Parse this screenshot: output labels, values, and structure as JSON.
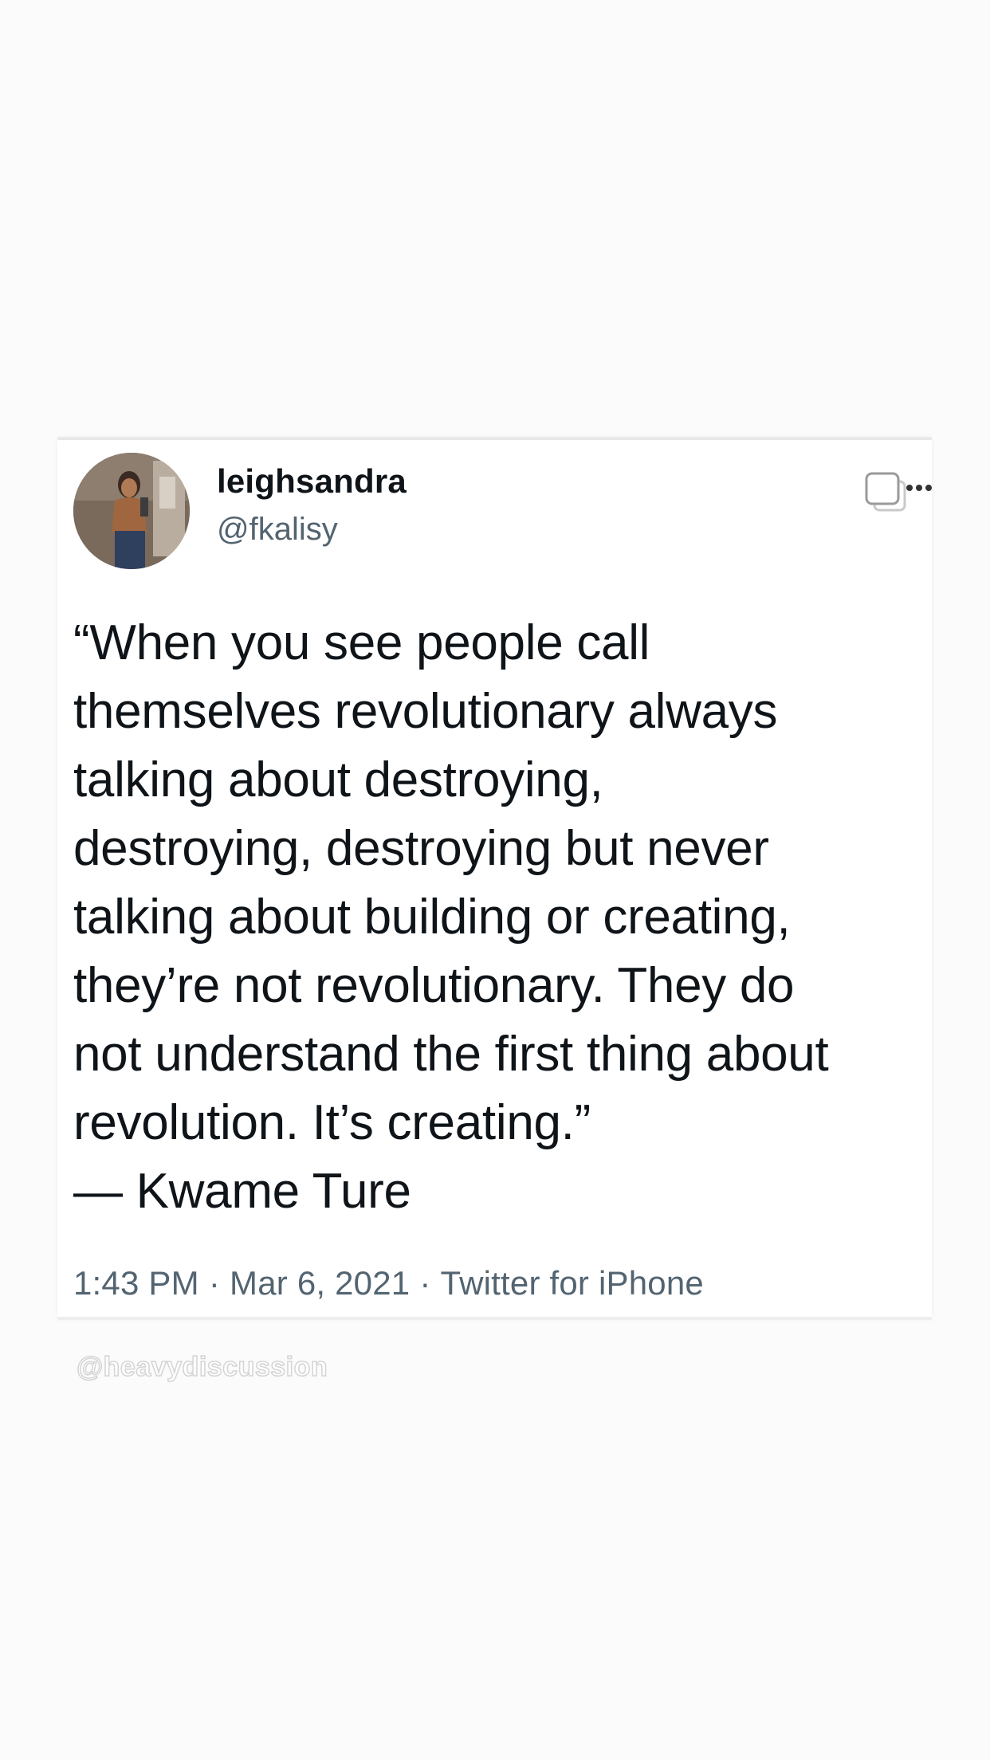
{
  "tweet": {
    "display_name": "leighsandra",
    "handle": "@fkalisy",
    "text": "“When you see people call\nthemselves revolutionary always\ntalking about destroying,\ndestroying, destroying but never\ntalking about building or creating,\nthey’re not revolutionary. They do\nnot understand the first thing about\nrevolution. It’s creating.”\n— Kwame Ture",
    "time": "1:43 PM",
    "date": "Mar 6, 2021",
    "source": "Twitter for iPhone",
    "separator": "·"
  },
  "watermark": "@heavydiscussion",
  "icons": {
    "avatar": "profile-photo",
    "more": "more-options-icon"
  },
  "colors": {
    "text": "#0f1419",
    "secondary": "#536471",
    "background": "#fbfbfb",
    "card": "#ffffff"
  }
}
